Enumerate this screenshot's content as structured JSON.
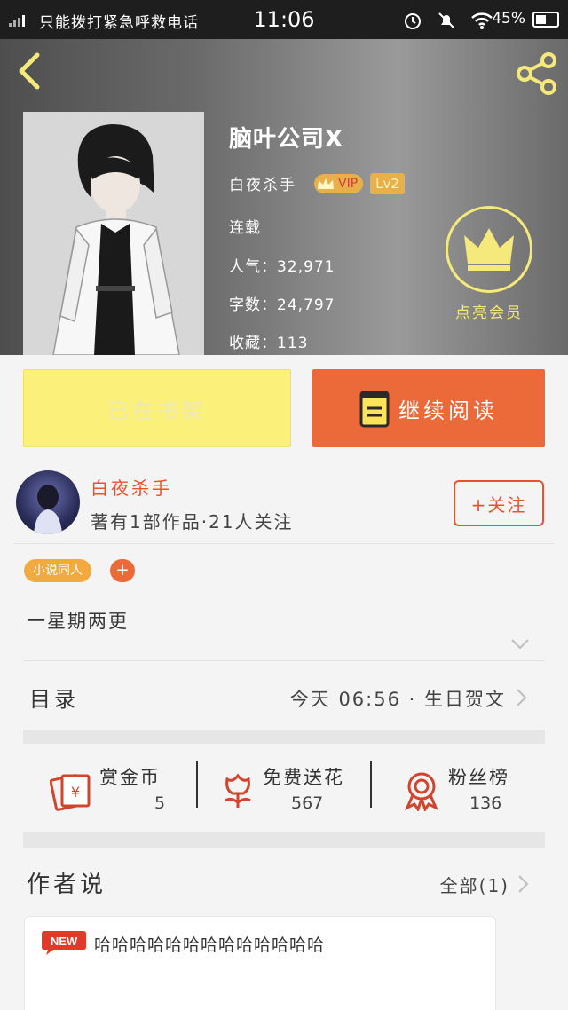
{
  "status_bar": {
    "emergency_text": "只能拨打紧急呼救电话",
    "time": "11:06",
    "battery_percent": "45%",
    "icons": [
      "alarm-icon",
      "mute-bell-icon",
      "wifi-icon",
      "battery-charging-icon"
    ]
  },
  "header": {
    "back_icon": "chevron-left-icon",
    "share_icon": "share-icon",
    "accent_color": "#f4e97a"
  },
  "book": {
    "title": "脑叶公司X",
    "author": "白夜杀手",
    "vip_label": "VIP",
    "level_label": "Lv2",
    "status": "连载",
    "popularity": "人气：32,971",
    "word_count": "字数：24,797",
    "favorites": "收藏：113"
  },
  "membership": {
    "label": "点亮会员"
  },
  "actions": {
    "shelf_label": "已在书架",
    "read_label": "继续阅读"
  },
  "author_card": {
    "name": "白夜杀手",
    "stats": "著有1部作品·21人关注",
    "follow_label": "+关注"
  },
  "tags": {
    "items": [
      "小说同人"
    ],
    "add_label": "+"
  },
  "description": "一星期两更",
  "toc": {
    "label": "目录",
    "latest": "今天 06:56 · 生日贺文"
  },
  "stats": [
    {
      "label": "赏金币",
      "value": "5",
      "icon": "red-envelope-icon"
    },
    {
      "label": "免费送花",
      "value": "567",
      "icon": "flower-icon"
    },
    {
      "label": "粉丝榜",
      "value": "136",
      "icon": "medal-icon"
    }
  ],
  "author_notes": {
    "title": "作者说",
    "all_label": "全部(1)",
    "items": [
      {
        "badge": "NEW",
        "text": "哈哈哈哈哈哈哈哈哈哈哈哈哈"
      }
    ]
  }
}
